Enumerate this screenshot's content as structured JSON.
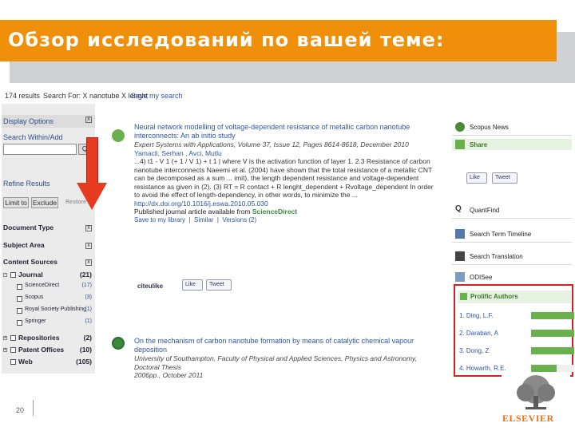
{
  "slide": {
    "title": "Обзор исследований по вашей теме:",
    "page_number": "20",
    "logo_text": "ELSEVIER",
    "brand_color": "#f0900a",
    "arrow_color": "#e53b20",
    "highlight_color": "#d62020"
  },
  "results_bar": {
    "count_text": "174 results",
    "query_text": "Search For: X nanotube X lenght",
    "save_link": "Save my search"
  },
  "left_panel": {
    "display_options": "Display Options",
    "search_within": "Search Within/Add",
    "search_input_value": "",
    "go_label": "Q",
    "refine_results": "Refine Results",
    "limit_to": "Limit to",
    "exclude": "Exclude",
    "restore": "Restore",
    "document_type": "Document Type",
    "subject_area": "Subject Area",
    "content_sources": "Content Sources",
    "sources": [
      {
        "label": "Journal",
        "count": "(21)",
        "bold": true
      },
      {
        "label": "ScienceDirect",
        "count": "(17)",
        "bold": false
      },
      {
        "label": "Scopus",
        "count": "(3)",
        "bold": false
      },
      {
        "label": "Royal Society Publishing",
        "count": "(1)",
        "bold": false
      },
      {
        "label": "Springer",
        "count": "(1)",
        "bold": false
      },
      {
        "label": "Repositories",
        "count": "(2)",
        "bold": true
      },
      {
        "label": "Patent Offices",
        "count": "(10)",
        "bold": true
      },
      {
        "label": "Web",
        "count": "(105)",
        "bold": true
      }
    ]
  },
  "results": [
    {
      "title": "Neural network modelling of voltage-dependent resistance of metallic carbon nanotube interconnects: An ab initio study",
      "meta": "Expert Systems with Applications, Volume 37, Issue 12, Pages 8614-8618, December 2010",
      "authors": "Yamacli, Serhan , Avci, Mutlu",
      "snippet": "...4) t1 - V 1 (+ 1 / V 1) + t 1 | where V is the activation function of layer 1. 2.3 Resistance of carbon nanotube interconnects Naeemi et al. (2004) have shown that the total resistance of a metallic CNT can be decomposed as a sum ... imit), the length dependent resistance and voltage-dependent resistance as given in (2). (3) RT = R contact + R lenght_dependent + Rvoltage_dependent In order to avoid the effect of length-dependency, in other words, to minimize the ...",
      "doi": "http://dx.doi.org/10.1016/j.eswa.2010.05.030",
      "available_prefix": "Published journal article available from ",
      "available_source": "ScienceDirect",
      "actions": [
        "Save to my library",
        "Similar",
        "Versions (2)"
      ],
      "citeulike": "citeulike",
      "like": "Like",
      "tweet": "Tweet"
    },
    {
      "title": "On the mechanism of carbon nanotube formation by means of catalytic chemical vapour deposition",
      "meta": "University of Southampton, Faculty of Physical and Applied Sciences, Physics and Astronomy, Doctoral Thesis",
      "date": "2006pp., October 2011"
    }
  ],
  "right_panel": {
    "items": [
      {
        "label": "Scopus News",
        "icon": "news-icon"
      },
      {
        "label": "Share",
        "icon": "share-icon"
      },
      {
        "label": "QuantFind",
        "icon": "quantfind-icon"
      },
      {
        "label": "Search Term Timeline",
        "icon": "timeline-icon"
      },
      {
        "label": "Search Translation",
        "icon": "translate-icon"
      },
      {
        "label": "ODISee",
        "icon": "odisee-icon"
      }
    ],
    "like": "Like",
    "tweet": "Tweet",
    "prolific_authors": "Prolific Authors",
    "authors": [
      {
        "name": "1. Ding, L.F.",
        "level": 1.0
      },
      {
        "name": "2. Daraban, A",
        "level": 1.0
      },
      {
        "name": "3. Dong, Z",
        "level": 1.0
      },
      {
        "name": "4. Howarth, R.E.",
        "level": 0.6
      }
    ]
  }
}
